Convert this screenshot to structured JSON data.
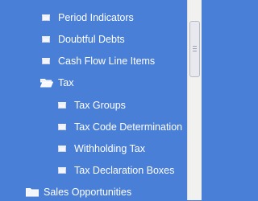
{
  "tree": {
    "items": [
      {
        "label": "Period Indicators",
        "icon": "document-icon"
      },
      {
        "label": "Doubtful Debts",
        "icon": "document-icon"
      },
      {
        "label": "Cash Flow Line Items",
        "icon": "document-icon"
      },
      {
        "label": "Tax",
        "icon": "open-folder-icon"
      },
      {
        "label": "Tax Groups",
        "icon": "document-icon"
      },
      {
        "label": "Tax Code Determination",
        "icon": "document-icon"
      },
      {
        "label": "Withholding Tax",
        "icon": "document-icon"
      },
      {
        "label": "Tax Declaration Boxes",
        "icon": "document-icon"
      },
      {
        "label": "Sales Opportunities",
        "icon": "closed-folder-icon"
      }
    ]
  },
  "colors": {
    "background": "#4a7fd8",
    "text": "#ffffff",
    "scrollbar": "#f1f1ef"
  }
}
